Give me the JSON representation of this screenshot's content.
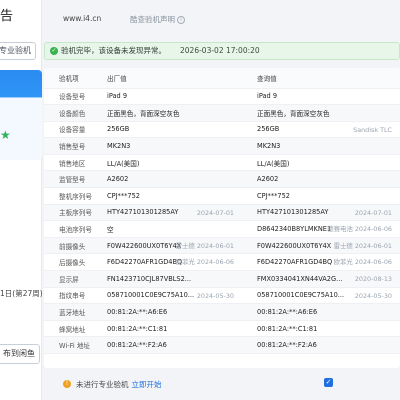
{
  "sidebar": {
    "title_fragment": "告",
    "pro_button_fragment": "专业验机",
    "date_fragment": "1日(第27周)",
    "bottom_button_fragment": "布到闲鱼"
  },
  "topbar": {
    "site": "www.i4.cn",
    "disclaimer": "酷查验机声明"
  },
  "banner": {
    "message": "验机完毕，该设备未发现异常。",
    "time": "2026-03-02 17:00:20"
  },
  "table": {
    "headers": [
      "验机项",
      "出厂值",
      "查询值"
    ],
    "rows": [
      {
        "item": "设备型号",
        "factory": "iPad 9",
        "factory_sub": "",
        "query": "iPad 9",
        "query_sub": ""
      },
      {
        "item": "设备颜色",
        "factory": "正面黑色，背面深空灰色",
        "factory_sub": "",
        "query": "正面黑色，背面深空灰色",
        "query_sub": ""
      },
      {
        "item": "设备容量",
        "factory": "256GB",
        "factory_sub": "",
        "query": "256GB",
        "query_sub": "Sandisk TLC"
      },
      {
        "item": "销售型号",
        "factory": "MK2N3",
        "factory_sub": "",
        "query": "MK2N3",
        "query_sub": ""
      },
      {
        "item": "销售地区",
        "factory": "LL/A(美国)",
        "factory_sub": "",
        "query": "LL/A(美国)",
        "query_sub": ""
      },
      {
        "item": "监管型号",
        "factory": "A2602",
        "factory_sub": "",
        "query": "A2602",
        "query_sub": ""
      },
      {
        "item": "整机序列号",
        "factory": "CPJ***752",
        "factory_sub": "",
        "query": "CPJ***752",
        "query_sub": ""
      },
      {
        "item": "主板序列号",
        "factory": "HTY427101301285AY",
        "factory_sub": "2024-07-01",
        "query": "HTY427101301285AY",
        "query_sub": "2024-07-01"
      },
      {
        "item": "电池序列号",
        "factory": "空",
        "factory_sub": "",
        "query": "D8642340B8YLMKNE1",
        "query_sub": "德赛电池 2024-06-06"
      },
      {
        "item": "前摄像头",
        "factory": "F0W422600UX0T6Y4X",
        "factory_sub": "雷士德 2024-06-01",
        "query": "F0W422600UX0T6Y4X",
        "query_sub": "雷士德 2024-06-01"
      },
      {
        "item": "后摄像头",
        "factory": "F6D42270AFR1GD4BQ",
        "factory_sub": "欧菲光 2024-06-06",
        "query": "F6D42270AFR1GD4BQ",
        "query_sub": "欧菲光 2024-06-06"
      },
      {
        "item": "显示屏",
        "factory": "FN1423710CJL87VBLS2...",
        "factory_sub": "",
        "query": "FMX0334041XN44VA2G...",
        "query_sub": "2020-08-13"
      },
      {
        "item": "指纹串号",
        "factory": "058710001C0E9C75A10...",
        "factory_sub": "2024-05-30",
        "query": "058710001C0E9C75A10...",
        "query_sub": "2024-05-30"
      },
      {
        "item": "蓝牙地址",
        "factory": "00:81:2A:**:A6:E6",
        "factory_sub": "",
        "query": "00:81:2A:**:A6:E6",
        "query_sub": ""
      },
      {
        "item": "蜂窝地址",
        "factory": "00:81:2A:**:C1:81",
        "factory_sub": "",
        "query": "00:81:2A:**:C1:81",
        "query_sub": ""
      },
      {
        "item": "Wi-Fi 地址",
        "factory": "00:81:2A:**:F2:A6",
        "factory_sub": "",
        "query": "00:81:2A:**:F2:A6",
        "query_sub": ""
      }
    ]
  },
  "bottom": {
    "text": "未进行专业验机",
    "link": "立即开始"
  },
  "colors": {
    "accent": "#1f6fe0",
    "ok_green": "#37b24d",
    "warn_orange": "#f0a020"
  }
}
